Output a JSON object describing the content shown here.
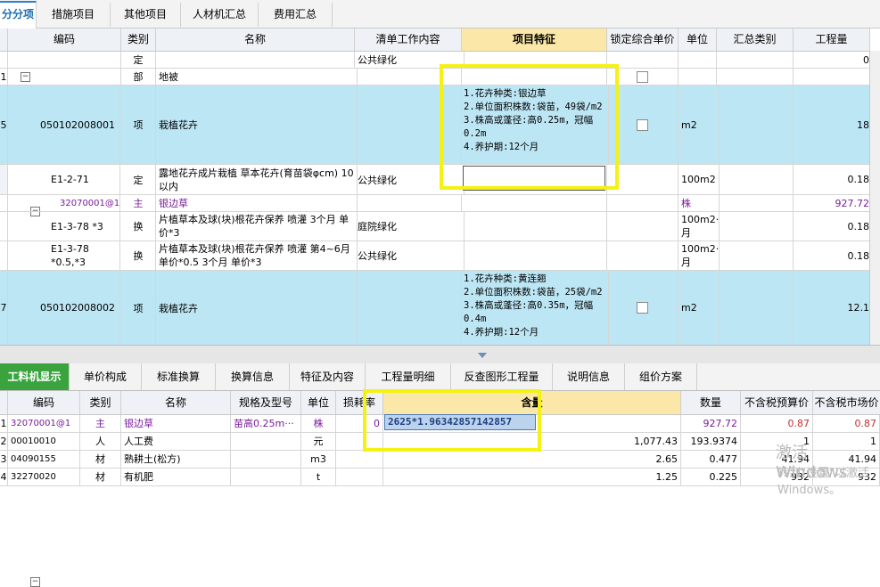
{
  "top_tabs": [
    "分分项",
    "措施项目",
    "其他项目",
    "人材机汇总",
    "费用汇总"
  ],
  "columns": {
    "code": "编码",
    "type": "类别",
    "name": "名称",
    "work": "清单工作内容",
    "feature": "项目特征",
    "lock": "锁定综合单价",
    "unit": "单位",
    "summary": "汇总类别",
    "qty": "工程量"
  },
  "rows": [
    {
      "idx": "",
      "code": "",
      "type": "定",
      "name": "",
      "work": "公共绿化",
      "feature": "",
      "unit": "",
      "qty": "0"
    },
    {
      "idx": "1",
      "code": "",
      "type": "部",
      "name": "地被",
      "work": "",
      "feature": "",
      "unit": "",
      "qty": ""
    },
    {
      "idx": "5",
      "code": "050102008001",
      "type": "项",
      "name": "栽植花卉",
      "work": "",
      "feature": "1.花卉种类:银边草\n2.单位面积株数:袋苗，49袋/m2\n3.株高或蓬径:高0.25m，冠幅0.2m\n4.养护期:12个月",
      "unit": "m2",
      "qty": "18"
    },
    {
      "idx": "",
      "code": "E1-2-71",
      "type": "定",
      "name": "露地花卉成片栽植 草本花卉(育苗袋φcm) 10以内",
      "work": "公共绿化",
      "feature": "",
      "unit": "100m2",
      "qty": "0.18"
    },
    {
      "idx": "",
      "code": "32070001@1",
      "type": "主",
      "name": "银边草",
      "work": "",
      "feature": "",
      "unit": "株",
      "qty": "927.72"
    },
    {
      "idx": "",
      "code": "E1-3-78 *3",
      "type": "换",
      "name": "片植草本及球(块)根花卉保养 喷灌 3个月 单价*3",
      "work": "庭院绿化",
      "feature": "",
      "unit": "100m2·月",
      "qty": "0.18"
    },
    {
      "idx": "",
      "code": "E1-3-78 *0.5,*3",
      "type": "换",
      "name": "片植草本及球(块)根花卉保养 喷灌 第4~6月 单价*0.5 3个月 单价*3",
      "work": "公共绿化",
      "feature": "",
      "unit": "100m2·月",
      "qty": "0.18"
    },
    {
      "idx": "7",
      "code": "050102008002",
      "type": "项",
      "name": "栽植花卉",
      "work": "",
      "feature": "1.花卉种类:黄连翘\n2.单位面积株数:袋苗，25袋/m2\n3.株高或蓬径:高0.35m，冠幅0.4m\n4.养护期:12个月",
      "unit": "m2",
      "qty": "12.1"
    }
  ],
  "bottom_tabs": [
    "工料机显示",
    "单价构成",
    "标准换算",
    "换算信息",
    "特征及内容",
    "工程量明细",
    "反查图形工程量",
    "说明信息",
    "组价方案"
  ],
  "bottom_columns": {
    "code": "编码",
    "type": "类别",
    "name": "名称",
    "spec": "规格及型号",
    "unit": "单位",
    "loss": "损耗率",
    "content": "含量",
    "qty": "数量",
    "price1": "不含税预算价",
    "price2": "不含税市场价"
  },
  "bottom_rows": [
    {
      "idx": "1",
      "code": "32070001@1",
      "type": "主",
      "name": "银边草",
      "spec": "苗高0.25m···",
      "unit": "株",
      "loss": "0",
      "content": "2625*1.96342857142857",
      "qty": "927.72",
      "price1": "0.87",
      "price2": "0.87"
    },
    {
      "idx": "2",
      "code": "00010010",
      "type": "人",
      "name": "人工费",
      "spec": "",
      "unit": "元",
      "loss": "",
      "content": "1,077.43",
      "qty": "193.9374",
      "price1": "1",
      "price2": "1"
    },
    {
      "idx": "3",
      "code": "04090155",
      "type": "材",
      "name": "熟耕土(松方)",
      "spec": "",
      "unit": "m3",
      "loss": "",
      "content": "2.65",
      "qty": "0.477",
      "price1": "41.94",
      "price2": "41.94"
    },
    {
      "idx": "4",
      "code": "32270020",
      "type": "材",
      "name": "有机肥",
      "spec": "",
      "unit": "t",
      "loss": "",
      "content": "1.25",
      "qty": "0.225",
      "price1": "932",
      "price2": "932"
    }
  ],
  "watermark": {
    "line1": "激活 Windows",
    "line2": "转到\"设置\"以激活 Windows。"
  },
  "colors": {
    "highlight_row": "#bde6f4",
    "annotation_box": "#f4f214",
    "active_tab": "#3aa33e"
  }
}
